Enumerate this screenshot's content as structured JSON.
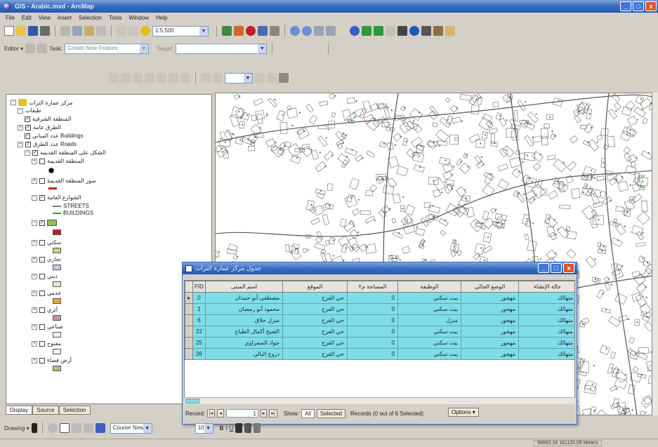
{
  "window": {
    "title": "GIS - Arabic.mxd - ArcMap",
    "minimize": "_",
    "maximize": "□",
    "close": "x"
  },
  "menu": [
    "File",
    "Edit",
    "View",
    "Insert",
    "Selection",
    "Tools",
    "Window",
    "Help"
  ],
  "toolbar": {
    "scale": "1:5,500",
    "editor": "Editor ▾",
    "target_label": "Task:",
    "task_value": "Create New Feature",
    "target_value": ""
  },
  "drawing": {
    "label": "Drawing ▾",
    "font": "Courier New",
    "font_size": "10"
  },
  "toc": {
    "tabs": [
      "Display",
      "Source",
      "Selection"
    ],
    "items": [
      {
        "label": "مركز عمارة الترات"
      },
      {
        "label": "طبقات"
      },
      {
        "label": "المنطقة الشرقية"
      },
      {
        "label": "الطرق عامة"
      },
      {
        "label": "عدد المباني Buildings"
      },
      {
        "label": "عدد الطرق Roads"
      },
      {
        "label": "الشكل على المنطقة القديمة"
      },
      {
        "label": "المنطقة القديمة"
      },
      {
        "label": "سور المنطقة القديمة"
      },
      {
        "label": "الشوارع العامة"
      },
      {
        "label": "STREETS"
      },
      {
        "label": "BUILDINGS"
      },
      {
        "label": "سكني"
      },
      {
        "label": "تجاري"
      },
      {
        "label": "ديني"
      },
      {
        "label": "خدمي"
      },
      {
        "label": "أثري"
      },
      {
        "label": "صناعي"
      },
      {
        "label": "مفتوح"
      },
      {
        "label": "أرض فضاء"
      }
    ]
  },
  "table_window": {
    "title": "جدول مركز عمارة التراث",
    "columns": [
      "FID",
      "اسم المبنى",
      "الموقع",
      "المساحة م٢",
      "الوظيفة",
      "الوضع الحالي",
      "حالة الإنشاء"
    ],
    "rows": [
      [
        "0",
        "مصطفى أبو حمدان",
        "حي الفرج",
        "0",
        "بيت سكني",
        "مهجور",
        "متهالك"
      ],
      [
        "1",
        "محمود أبو رمضان",
        "حي الفرج",
        "0",
        "بيت سكني",
        "مهجور",
        "متهالك"
      ],
      [
        "6",
        "منزل حلاق",
        "حي الفرج",
        "0",
        "منزل",
        "مهجور",
        "متهالك"
      ],
      [
        "22",
        "الشيخ أكمال الطباع",
        "حي الفرج",
        "0",
        "بيت سكني",
        "مهجور",
        "متهالك"
      ],
      [
        "25",
        "جواد السعراوي",
        "حي الفرج",
        "0",
        "بيت سكني",
        "مهجور",
        "متهالك"
      ],
      [
        "26",
        "دروج البالي",
        "حي الفرج",
        "0",
        "بيت سكني",
        "مهجور",
        "متهالك"
      ]
    ],
    "current_row_marker": "▸",
    "record_label": "Record:",
    "record_value": "1",
    "show_label": "Show:",
    "show_all": "All",
    "show_selected": "Selected",
    "records_text": "Records (0 out of 6 Selected)",
    "options_label": "Options ▾"
  },
  "status": {
    "coords": "99863.16  161120.09 Meters"
  }
}
